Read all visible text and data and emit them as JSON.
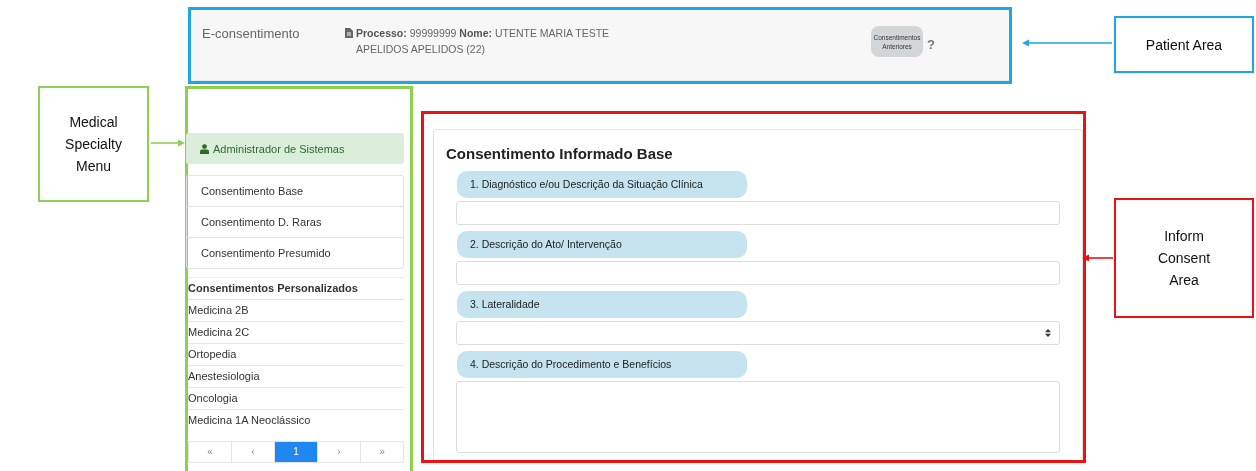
{
  "header": {
    "app_title": "E-consentimento",
    "patient_info": "**Processo:** 99999999 **Nome:** UTENTE MARIA TESTE APELIDOS APELIDOS (22)",
    "history_button": "Consentimentos Anteriores",
    "help": "?"
  },
  "sidebar": {
    "role": "Administrador de Sistemas",
    "base_items": [
      "Consentimento Base",
      "Consentimento D. Raras",
      "Consentimento Presumido"
    ],
    "section_title": "Consentimentos Personalizados",
    "custom_items": [
      "Medicina 2B",
      "Medicina 2C",
      "Ortopedia",
      "Anestesiologia",
      "Oncologia",
      "Medicina 1A Neoclássico"
    ],
    "pagination": [
      {
        "label": "«",
        "selected": false
      },
      {
        "label": "‹",
        "selected": false
      },
      {
        "label": "1",
        "selected": true
      },
      {
        "label": "›",
        "selected": false
      },
      {
        "label": "»",
        "selected": false
      }
    ]
  },
  "form": {
    "title": "Consentimento Informado Base",
    "fields": [
      {
        "kind": "text",
        "label": "1. Diagnóstico e/ou Descrição da Situação Clínica"
      },
      {
        "kind": "text",
        "label": "2. Descrição do Ato/ Intervenção"
      },
      {
        "kind": "select",
        "label": "3. Lateralidade"
      },
      {
        "kind": "textarea",
        "label": "4. Descrição do Procedimento e Benefícios"
      }
    ]
  },
  "callouts": [
    {
      "label": "Patient Area",
      "color": "#1aa8e6"
    },
    {
      "label": "Medical Specialty Menu",
      "color": "#8fd14f"
    },
    {
      "label": "Inform Consent Area",
      "color": "#ee1111"
    }
  ]
}
